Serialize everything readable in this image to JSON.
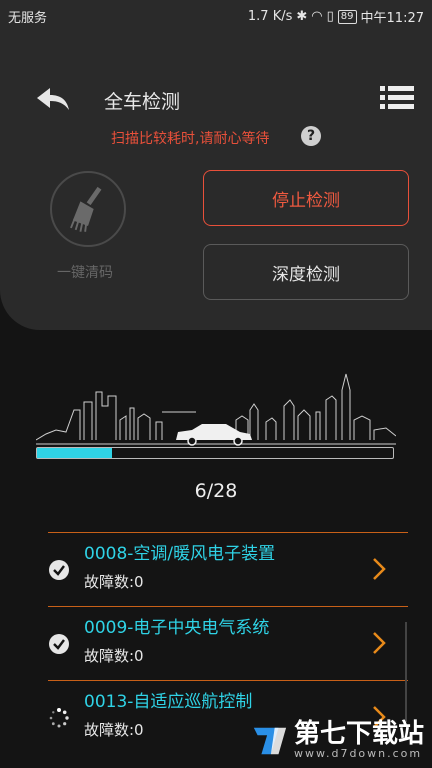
{
  "status_bar": {
    "carrier": "无服务",
    "network_speed": "1.7 K/s",
    "battery": "89",
    "time": "中午11:27"
  },
  "header": {
    "title": "全车检测",
    "back_icon": "back-arrow-icon",
    "menu_icon": "list-menu-icon"
  },
  "notice": {
    "text": "扫描比较耗时,请耐心等待",
    "help_glyph": "?"
  },
  "actions": {
    "clean_label": "一键清码",
    "stop_label": "停止检测",
    "deep_label": "深度检测"
  },
  "progress": {
    "current": 6,
    "total": 28,
    "text": "6/28",
    "fraction": 0.21
  },
  "modules": [
    {
      "name": "0008-空调/暖风电子装置",
      "fault": "故障数:0",
      "status": "done"
    },
    {
      "name": "0009-电子中央电气系统",
      "fault": "故障数:0",
      "status": "done"
    },
    {
      "name": "0013-自适应巡航控制",
      "fault": "故障数:0",
      "status": "loading"
    }
  ],
  "watermark": {
    "brand": "第七下载站",
    "url": "www.d7down.com"
  },
  "colors": {
    "accent_cyan": "#2fd3e6",
    "warning_red": "#e8503a",
    "arrow_orange": "#e88a1a"
  }
}
